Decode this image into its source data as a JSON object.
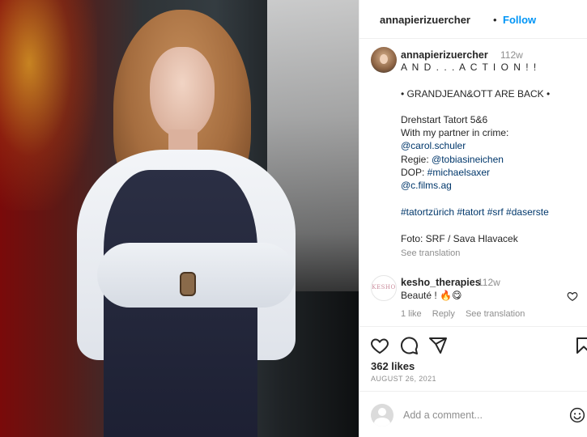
{
  "post": {
    "username": "annapierizuercher",
    "follow_label": "Follow",
    "header_separator": "•"
  },
  "caption": {
    "username": "annapierizuercher",
    "time": "112w",
    "lines": [
      "A N D . . . A C T I O N ! !",
      "• GRANDJEAN&OTT ARE BACK •",
      "Drehstart Tatort 5&6",
      "With my partner in crime:"
    ],
    "mention_carol": "@carol.schuler",
    "regie_label": "Regie: ",
    "mention_tobias": "@tobiasineichen",
    "dop_label": "DOP: ",
    "hashtag_michael": "#michaelsaxer",
    "mention_cfilms": "@c.films.ag",
    "hashtags": "#tatortzürich #tatort #srf #daserste",
    "foto": "Foto: SRF / Sava Hlavacek",
    "see_translation": "See translation"
  },
  "comment": {
    "username": "kesho_therapies",
    "time": "112w",
    "text": "Beauté ! 🔥😋",
    "likes": "1 like",
    "reply": "Reply",
    "see_translation": "See translation",
    "avatar_text": "KESHO"
  },
  "stats": {
    "likes": "362 likes",
    "date": "AUGUST 26, 2021"
  },
  "add_comment": {
    "placeholder": "Add a comment..."
  },
  "icons": {
    "like": "heart-icon",
    "comment": "comment-icon",
    "share": "share-icon",
    "save": "bookmark-icon",
    "emoji": "emoji-icon"
  }
}
